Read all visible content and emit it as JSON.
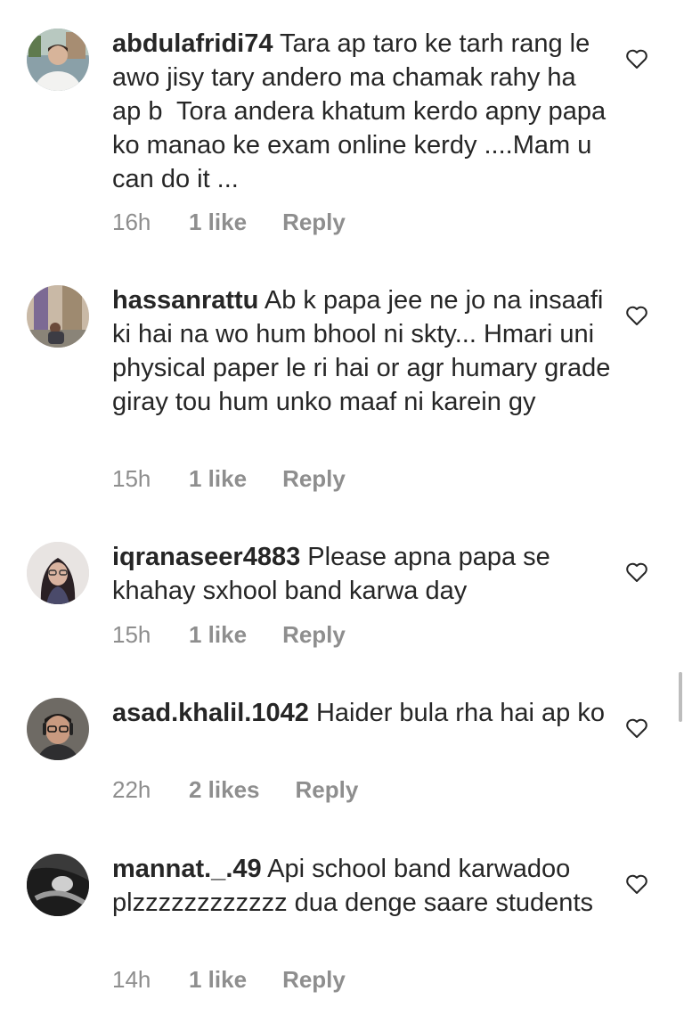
{
  "comments": [
    {
      "username": "abdulafridi74",
      "text": "Tara ap taro ke tarh rang le awo jisy tary andero ma chamak rahy ha ap b  Tora andera khatum kerdo apny papa ko manao ke exam online kerdy ....Mam u can do it ...",
      "time": "16h",
      "likes": "1 like",
      "reply": "Reply",
      "avatar_icon": "avatar-man-outdoor"
    },
    {
      "username": "hassanrattu",
      "text": "Ab k papa jee ne jo na insaafi ki hai na wo hum bhool ni skty... Hmari uni physical paper le ri hai or agr humary grade giray tou hum unko maaf ni karein gy",
      "time": "15h",
      "likes": "1 like",
      "reply": "Reply",
      "avatar_icon": "avatar-man-street"
    },
    {
      "username": "iqranaseer4883",
      "text": "Please apna papa se khahay sxhool band karwa day",
      "time": "15h",
      "likes": "1 like",
      "reply": "Reply",
      "avatar_icon": "avatar-woman-glasses"
    },
    {
      "username": "asad.khalil.1042",
      "text": "Haider bula rha hai ap ko",
      "time": "22h",
      "likes": "2 likes",
      "reply": "Reply",
      "avatar_icon": "avatar-man-glasses"
    },
    {
      "username": "mannat._.49",
      "text": "Api school band karwadoo plzzzzzzzzzzzz dua denge saare students",
      "time": "14h",
      "likes": "1 like",
      "reply": "Reply",
      "avatar_icon": "avatar-bw-photo"
    }
  ],
  "colors": {
    "text": "#262626",
    "meta": "#8e8e8e",
    "heart_outline": "#262626"
  }
}
